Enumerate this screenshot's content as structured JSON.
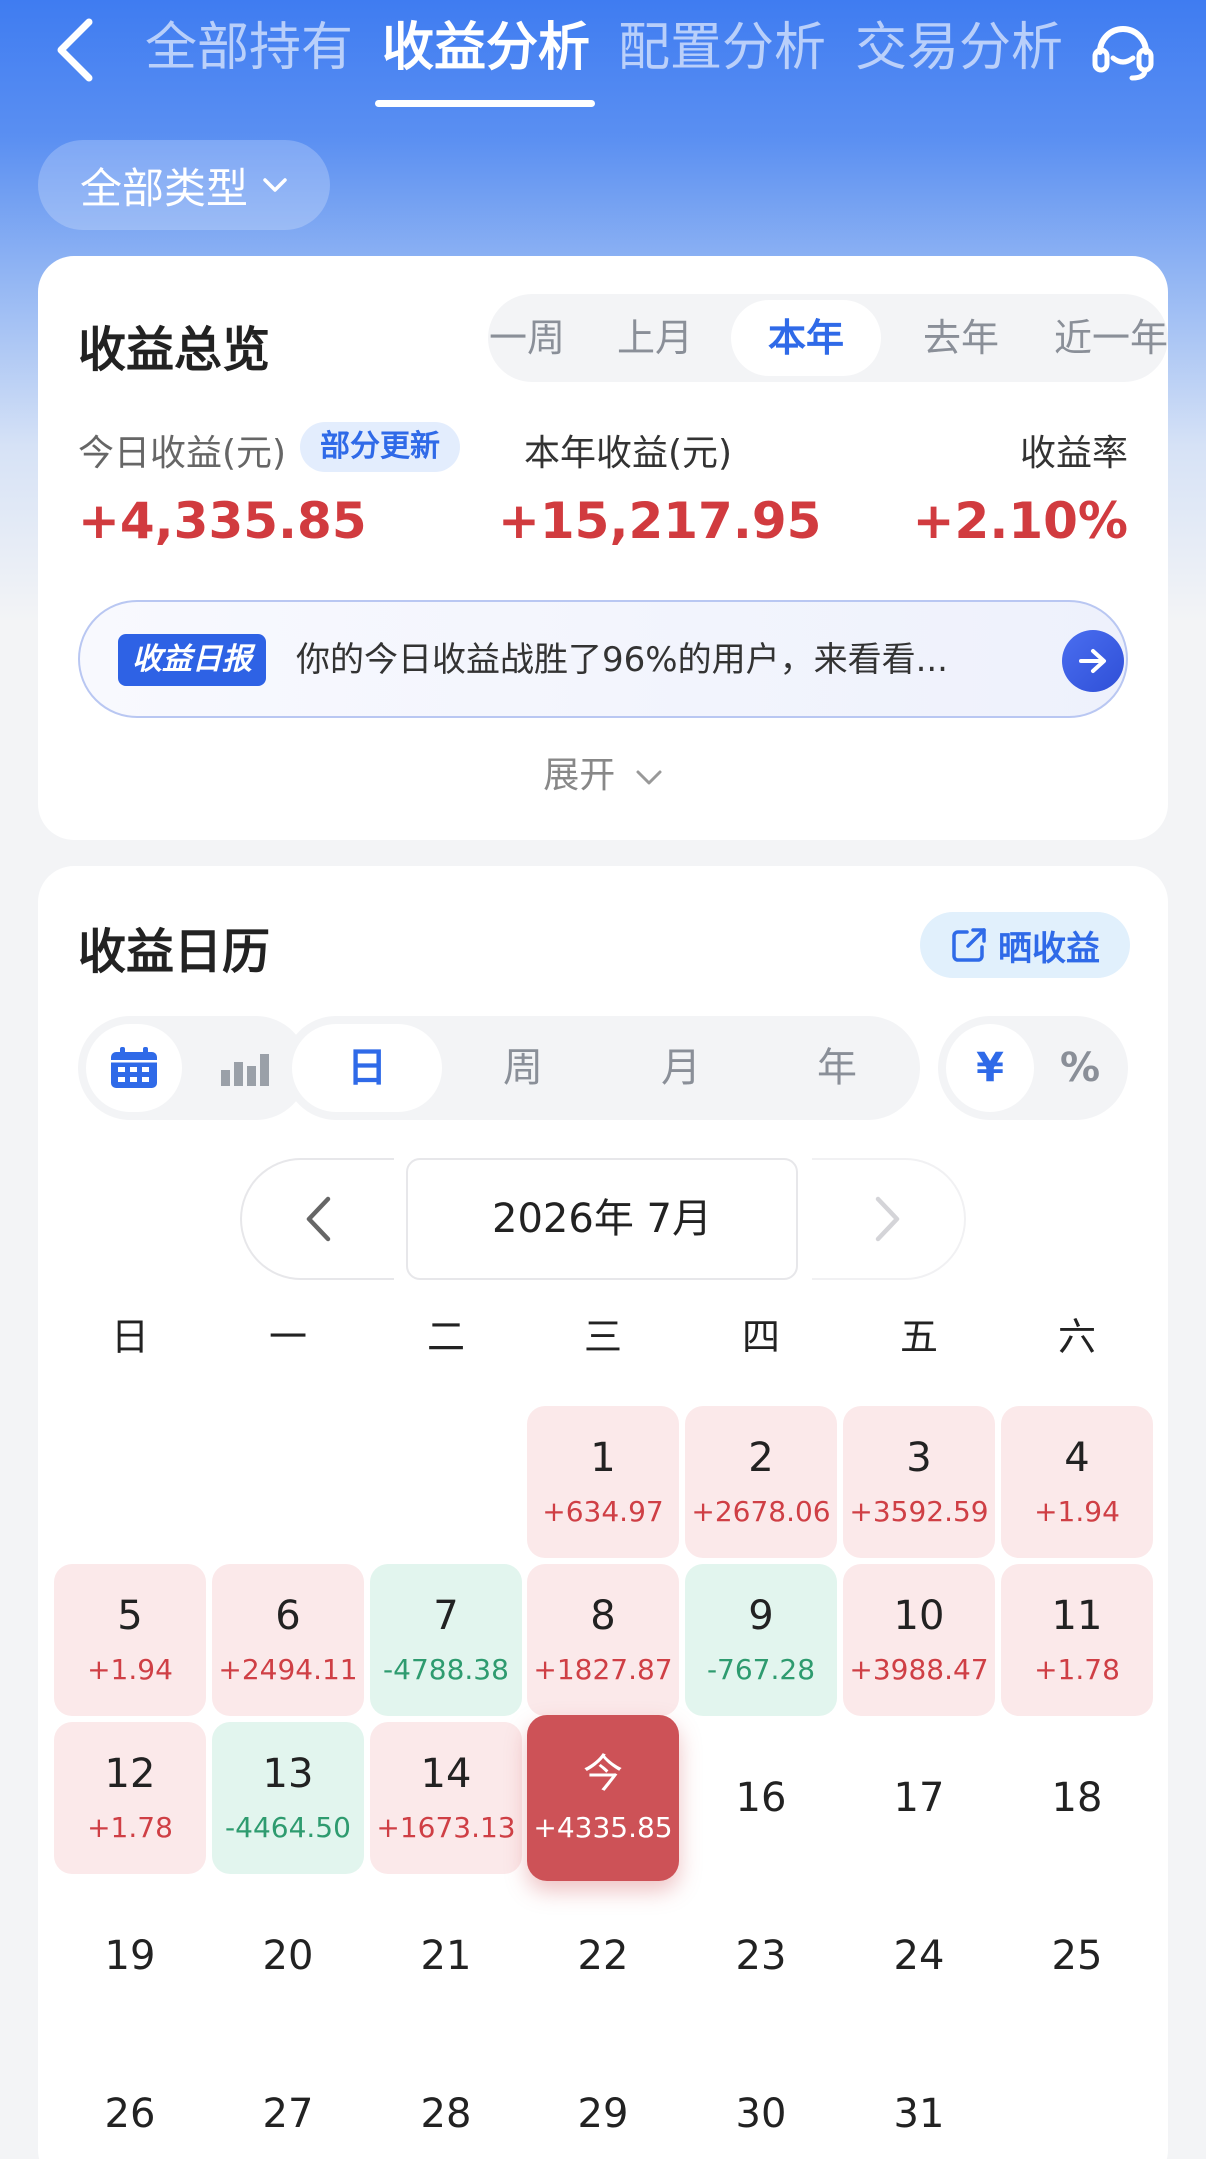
{
  "nav": {
    "tabs": [
      {
        "label": "全部持有",
        "active": false
      },
      {
        "label": "收益分析",
        "active": true
      },
      {
        "label": "配置分析",
        "active": false
      },
      {
        "label": "交易分析",
        "active": false
      }
    ]
  },
  "filter": {
    "label": "全部类型"
  },
  "overview": {
    "title": "收益总览",
    "periods": [
      {
        "label": "近一周",
        "active": false
      },
      {
        "label": "上月",
        "active": false
      },
      {
        "label": "本年",
        "active": true
      },
      {
        "label": "去年",
        "active": false
      },
      {
        "label": "近一年",
        "active": false
      }
    ],
    "today_label": "今日收益(元)",
    "update_badge": "部分更新",
    "today_value": "+4,335.85",
    "year_label": "本年收益(元)",
    "year_value": "+15,217.95",
    "rate_label": "收益率",
    "rate_value": "+2.10%",
    "report_tag": "收益日报",
    "report_text": "你的今日收益战胜了96%的用户，来看看...",
    "expand_label": "展开"
  },
  "calendar": {
    "title": "收益日历",
    "share_label": "晒收益",
    "granularity": [
      {
        "label": "日",
        "active": true
      },
      {
        "label": "周",
        "active": false
      },
      {
        "label": "月",
        "active": false
      },
      {
        "label": "年",
        "active": false
      }
    ],
    "unit": [
      {
        "label": "¥",
        "active": true
      },
      {
        "label": "%",
        "active": false
      }
    ],
    "month_label": "2026年 7月",
    "weekdays": [
      "日",
      "一",
      "二",
      "三",
      "四",
      "五",
      "六"
    ],
    "days": [
      {
        "day": "1",
        "amount": "+634.97",
        "type": "pos"
      },
      {
        "day": "2",
        "amount": "+2678.06",
        "type": "pos"
      },
      {
        "day": "3",
        "amount": "+3592.59",
        "type": "pos"
      },
      {
        "day": "4",
        "amount": "+1.94",
        "type": "pos"
      },
      {
        "day": "5",
        "amount": "+1.94",
        "type": "pos"
      },
      {
        "day": "6",
        "amount": "+2494.11",
        "type": "pos"
      },
      {
        "day": "7",
        "amount": "-4788.38",
        "type": "neg"
      },
      {
        "day": "8",
        "amount": "+1827.87",
        "type": "pos"
      },
      {
        "day": "9",
        "amount": "-767.28",
        "type": "neg"
      },
      {
        "day": "10",
        "amount": "+3988.47",
        "type": "pos"
      },
      {
        "day": "11",
        "amount": "+1.78",
        "type": "pos"
      },
      {
        "day": "12",
        "amount": "+1.78",
        "type": "pos"
      },
      {
        "day": "13",
        "amount": "-4464.50",
        "type": "neg"
      },
      {
        "day": "14",
        "amount": "+1673.13",
        "type": "pos"
      },
      {
        "day": "今",
        "amount": "+4335.85",
        "type": "today"
      },
      {
        "day": "16",
        "amount": "",
        "type": "none"
      },
      {
        "day": "17",
        "amount": "",
        "type": "none"
      },
      {
        "day": "18",
        "amount": "",
        "type": "none"
      },
      {
        "day": "19",
        "amount": "",
        "type": "none"
      },
      {
        "day": "20",
        "amount": "",
        "type": "none"
      },
      {
        "day": "21",
        "amount": "",
        "type": "none"
      },
      {
        "day": "22",
        "amount": "",
        "type": "none"
      },
      {
        "day": "23",
        "amount": "",
        "type": "none"
      },
      {
        "day": "24",
        "amount": "",
        "type": "none"
      },
      {
        "day": "25",
        "amount": "",
        "type": "none"
      },
      {
        "day": "26",
        "amount": "",
        "type": "none"
      },
      {
        "day": "27",
        "amount": "",
        "type": "none"
      },
      {
        "day": "28",
        "amount": "",
        "type": "none"
      },
      {
        "day": "29",
        "amount": "",
        "type": "none"
      },
      {
        "day": "30",
        "amount": "",
        "type": "none"
      },
      {
        "day": "31",
        "amount": "",
        "type": "none"
      }
    ]
  },
  "icons": {
    "back": "chevron-left-icon",
    "service": "headset-icon",
    "filter_arrow": "chevron-down-icon",
    "report_arrow": "arrow-right-icon",
    "share": "share-out-icon",
    "calendar_view": "calendar-icon",
    "chart_view": "bar-chart-icon"
  },
  "colors": {
    "accent": "#2f6ae8",
    "gain": "#d13b3f",
    "loss": "#2e9b6f",
    "today": "#cd5257"
  }
}
